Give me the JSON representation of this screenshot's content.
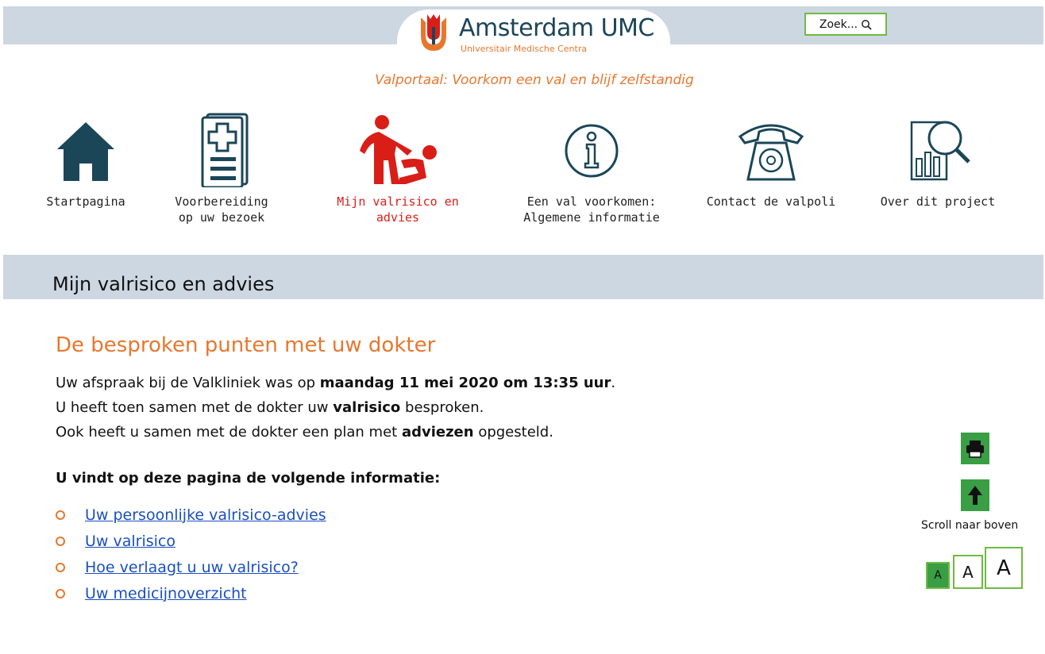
{
  "header": {
    "logo_name": "Amsterdam UMC",
    "logo_sub": "Universitair Medische Centra",
    "search_label": "Zoek...",
    "tagline": "Valportaal: Voorkom een val en blijf zelfstandig"
  },
  "nav": [
    {
      "line1": "Startpagina",
      "line2": "",
      "icon": "home-icon"
    },
    {
      "line1": "Voorbereiding",
      "line2": "op uw bezoek",
      "icon": "medical-document-icon"
    },
    {
      "line1": "Mijn valrisico en advies",
      "line2": "",
      "icon": "falling-person-icon"
    },
    {
      "line1": "Een val voorkomen:",
      "line2": "Algemene informatie",
      "icon": "info-icon"
    },
    {
      "line1": "Contact de valpoli",
      "line2": "",
      "icon": "telephone-icon"
    },
    {
      "line1": "Over dit project",
      "line2": "",
      "icon": "magnifier-report-icon"
    }
  ],
  "section_title": "Mijn valrisico en advies",
  "content": {
    "heading": "De besproken punten met uw dokter",
    "p1_pre": "Uw afspraak bij de Valkliniek was op ",
    "p1_bold": "maandag 11 mei 2020 om 13:35 uur",
    "p1_post": ".",
    "p2_pre": "U heeft toen samen met de dokter uw ",
    "p2_bold": "valrisico",
    "p2_post": " besproken.",
    "p3_pre": "Ook heeft u samen met de dokter een plan met ",
    "p3_bold": "adviezen",
    "p3_post": " opgesteld.",
    "toc_heading": "U vindt op deze pagina de volgende informatie:",
    "toc": [
      "Uw persoonlijke valrisico-advies",
      "Uw valrisico",
      "Hoe verlaagt u uw valrisico?",
      "Uw medicijnoverzicht"
    ]
  },
  "tools": {
    "scroll_label": "Scroll naar boven",
    "font_small": "A",
    "font_medium": "A",
    "font_large": "A"
  },
  "colors": {
    "accent_orange": "#e8772e",
    "nav_dark": "#1b4658",
    "active_red": "#d91e18",
    "green": "#3a9e44",
    "bar": "#cdd7e2"
  }
}
